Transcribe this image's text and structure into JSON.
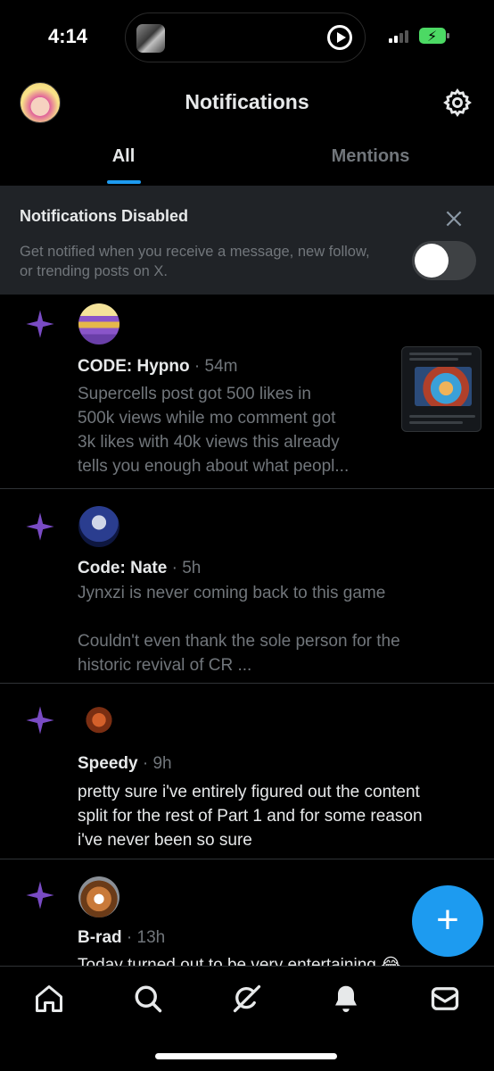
{
  "status_bar": {
    "time": "4:14"
  },
  "header": {
    "title": "Notifications",
    "avatar_icon": "profile-avatar",
    "settings_icon": "gear-icon"
  },
  "tabs": [
    {
      "label": "All",
      "active": true
    },
    {
      "label": "Mentions",
      "active": false
    }
  ],
  "banner": {
    "title": "Notifications Disabled",
    "text": "Get notified when you receive a message, new follow, or trending posts on X.",
    "toggle_on": false
  },
  "notifications": [
    {
      "name": "CODE: Hypno",
      "time": "54m",
      "body": "Supercells post got 500 likes in\n500k views while mo comment got\n3k likes with 40k views this already\ntells you enough about what peopl...",
      "has_thumbnail": true
    },
    {
      "name": "Code: Nate",
      "time": "5h",
      "body": "Jynxzi is never coming back to this game\n\nCouldn't even thank the sole person for the\nhistoric revival of CR ..."
    },
    {
      "name": "Speedy",
      "time": "9h",
      "body": "pretty sure i've entirely figured out the content\nsplit for the rest of Part 1 and for some reason\ni've never been so sure"
    },
    {
      "name": "B-rad",
      "time": "13h",
      "body": "Today turned out to be very entertaining 😂"
    }
  ],
  "separator": " · ",
  "fab_label": "+",
  "colors": {
    "accent": "#1d9bf0",
    "sparkle": "#794bc4",
    "muted_text": "#71767b",
    "banner_bg": "#202327"
  },
  "bottom_nav": [
    "home-icon",
    "search-icon",
    "grok-icon",
    "notifications-bell-icon",
    "messages-icon"
  ]
}
